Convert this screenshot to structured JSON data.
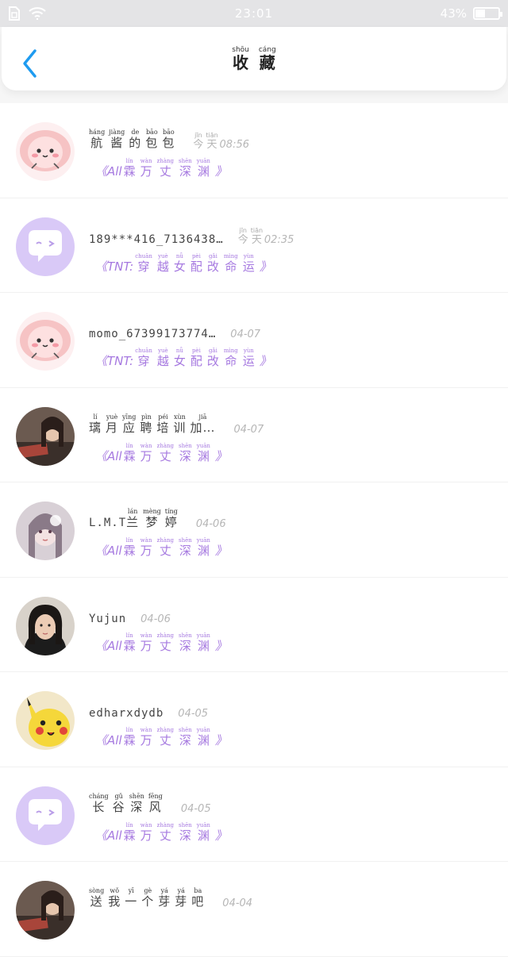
{
  "status_bar": {
    "time": "23:01",
    "battery": "43%",
    "battery_level": 0.43
  },
  "header": {
    "title": [
      {
        "char": "收",
        "pinyin": "shōu"
      },
      {
        "char": "藏",
        "pinyin": "cáng"
      }
    ]
  },
  "items": [
    {
      "avatar": "pink-blob",
      "name_prefix": "",
      "name": [
        {
          "char": "航",
          "pinyin": "háng"
        },
        {
          "char": "酱",
          "pinyin": "jiàng"
        },
        {
          "char": "的",
          "pinyin": "de"
        },
        {
          "char": "包",
          "pinyin": "bāo"
        },
        {
          "char": "包",
          "pinyin": "bāo"
        }
      ],
      "time_words": [
        {
          "char": "今",
          "pinyin": "jīn"
        },
        {
          "char": "天",
          "pinyin": "tiān"
        }
      ],
      "time": "08:56",
      "book_prefix": "《All",
      "book": [
        {
          "char": "霖",
          "pinyin": "lín"
        },
        {
          "char": "万",
          "pinyin": "wàn"
        },
        {
          "char": "丈",
          "pinyin": "zhàng"
        },
        {
          "char": "深",
          "pinyin": "shēn"
        },
        {
          "char": "渊",
          "pinyin": "yuān"
        }
      ],
      "book_suffix": "》"
    },
    {
      "avatar": "purple-bubble",
      "name_prefix": "189***416_7136438…",
      "name": [],
      "time_words": [
        {
          "char": "今",
          "pinyin": "jīn"
        },
        {
          "char": "天",
          "pinyin": "tiān"
        }
      ],
      "time": "02:35",
      "book_prefix": "《TNT:",
      "book": [
        {
          "char": "穿",
          "pinyin": "chuān"
        },
        {
          "char": "越",
          "pinyin": "yuè"
        },
        {
          "char": "女",
          "pinyin": "nǚ"
        },
        {
          "char": "配",
          "pinyin": "pèi"
        },
        {
          "char": "改",
          "pinyin": "gǎi"
        },
        {
          "char": "命",
          "pinyin": "mìng"
        },
        {
          "char": "运",
          "pinyin": "yùn"
        }
      ],
      "book_suffix": "》"
    },
    {
      "avatar": "pink-blob",
      "name_prefix": "momo_67399173774…",
      "name": [],
      "time_words": [],
      "time": "04-07",
      "book_prefix": "《TNT:",
      "book": [
        {
          "char": "穿",
          "pinyin": "chuān"
        },
        {
          "char": "越",
          "pinyin": "yuè"
        },
        {
          "char": "女",
          "pinyin": "nǚ"
        },
        {
          "char": "配",
          "pinyin": "pèi"
        },
        {
          "char": "改",
          "pinyin": "gǎi"
        },
        {
          "char": "命",
          "pinyin": "mìng"
        },
        {
          "char": "运",
          "pinyin": "yùn"
        }
      ],
      "book_suffix": "》"
    },
    {
      "avatar": "photo-dark",
      "name_prefix": "",
      "name": [
        {
          "char": "璃",
          "pinyin": "lí"
        },
        {
          "char": "月",
          "pinyin": "yuè"
        },
        {
          "char": "应",
          "pinyin": "yīng"
        },
        {
          "char": "聘",
          "pinyin": "pìn"
        },
        {
          "char": "培",
          "pinyin": "péi"
        },
        {
          "char": "训",
          "pinyin": "xùn"
        },
        {
          "char": "加…",
          "pinyin": "jiā"
        }
      ],
      "time_words": [],
      "time": "04-07",
      "book_prefix": "《All",
      "book": [
        {
          "char": "霖",
          "pinyin": "lín"
        },
        {
          "char": "万",
          "pinyin": "wàn"
        },
        {
          "char": "丈",
          "pinyin": "zhàng"
        },
        {
          "char": "深",
          "pinyin": "shēn"
        },
        {
          "char": "渊",
          "pinyin": "yuān"
        }
      ],
      "book_suffix": "》"
    },
    {
      "avatar": "anime-girl",
      "name_prefix": "L.M.T",
      "name": [
        {
          "char": "兰",
          "pinyin": "lán"
        },
        {
          "char": "梦",
          "pinyin": "mèng"
        },
        {
          "char": "婷",
          "pinyin": "tíng"
        }
      ],
      "time_words": [],
      "time": "04-06",
      "book_prefix": "《All",
      "book": [
        {
          "char": "霖",
          "pinyin": "lín"
        },
        {
          "char": "万",
          "pinyin": "wàn"
        },
        {
          "char": "丈",
          "pinyin": "zhàng"
        },
        {
          "char": "深",
          "pinyin": "shēn"
        },
        {
          "char": "渊",
          "pinyin": "yuān"
        }
      ],
      "book_suffix": "》"
    },
    {
      "avatar": "photo-girl",
      "name_prefix": "Yujun",
      "name": [],
      "time_words": [],
      "time": "04-06",
      "book_prefix": "《All",
      "book": [
        {
          "char": "霖",
          "pinyin": "lín"
        },
        {
          "char": "万",
          "pinyin": "wàn"
        },
        {
          "char": "丈",
          "pinyin": "zhàng"
        },
        {
          "char": "深",
          "pinyin": "shēn"
        },
        {
          "char": "渊",
          "pinyin": "yuān"
        }
      ],
      "book_suffix": "》"
    },
    {
      "avatar": "pikachu",
      "name_prefix": "edharxdydb",
      "name": [],
      "time_words": [],
      "time": "04-05",
      "book_prefix": "《All",
      "book": [
        {
          "char": "霖",
          "pinyin": "lín"
        },
        {
          "char": "万",
          "pinyin": "wàn"
        },
        {
          "char": "丈",
          "pinyin": "zhàng"
        },
        {
          "char": "深",
          "pinyin": "shēn"
        },
        {
          "char": "渊",
          "pinyin": "yuān"
        }
      ],
      "book_suffix": "》"
    },
    {
      "avatar": "purple-bubble",
      "name_prefix": "",
      "name": [
        {
          "char": "长",
          "pinyin": "cháng"
        },
        {
          "char": "谷",
          "pinyin": "gǔ"
        },
        {
          "char": "深",
          "pinyin": "shēn"
        },
        {
          "char": "风",
          "pinyin": "fēng"
        }
      ],
      "time_words": [],
      "time": "04-05",
      "book_prefix": "《All",
      "book": [
        {
          "char": "霖",
          "pinyin": "lín"
        },
        {
          "char": "万",
          "pinyin": "wàn"
        },
        {
          "char": "丈",
          "pinyin": "zhàng"
        },
        {
          "char": "深",
          "pinyin": "shēn"
        },
        {
          "char": "渊",
          "pinyin": "yuān"
        }
      ],
      "book_suffix": "》"
    },
    {
      "avatar": "photo-dark",
      "name_prefix": "",
      "name": [
        {
          "char": "送",
          "pinyin": "sòng"
        },
        {
          "char": "我",
          "pinyin": "wǒ"
        },
        {
          "char": "一",
          "pinyin": "yī"
        },
        {
          "char": "个",
          "pinyin": "gè"
        },
        {
          "char": "芽",
          "pinyin": "yá"
        },
        {
          "char": "芽",
          "pinyin": "yá"
        },
        {
          "char": "吧",
          "pinyin": "ba"
        }
      ],
      "time_words": [],
      "time": "04-04",
      "book_prefix": "",
      "book": [],
      "book_suffix": ""
    }
  ],
  "colors": {
    "accent": "#a679e0",
    "back": "#1e9bf0",
    "meta": "#b6b6b6"
  }
}
